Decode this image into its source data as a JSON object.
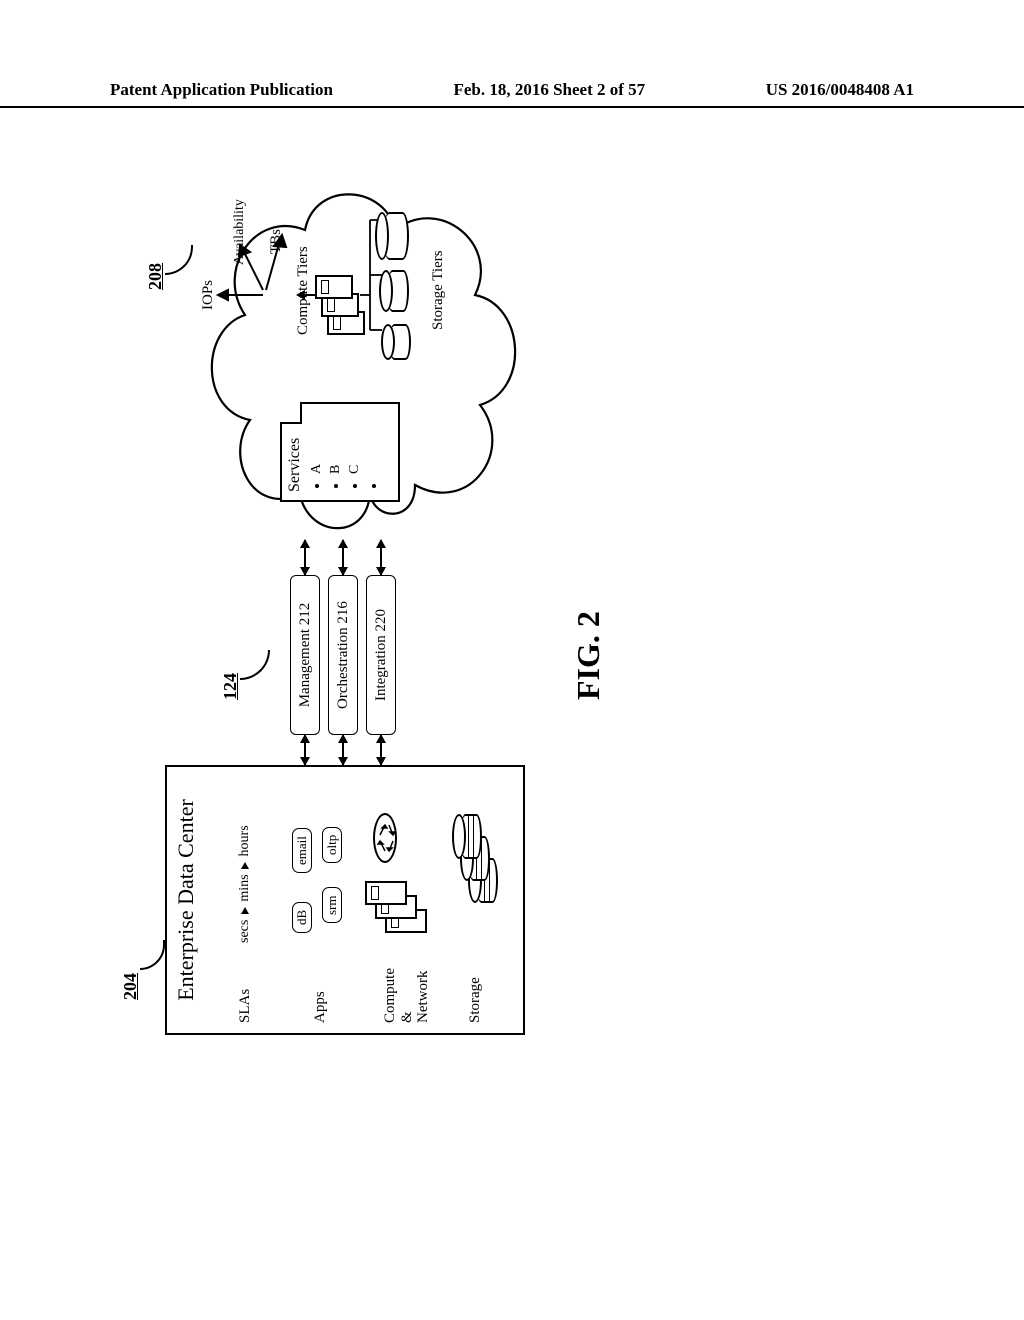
{
  "header": {
    "left": "Patent Application Publication",
    "center": "Feb. 18, 2016  Sheet 2 of 57",
    "right": "US 2016/0048408 A1"
  },
  "figure": {
    "label": "FIG.  2"
  },
  "refs": {
    "r204": "204",
    "r124": "124",
    "r208": "208"
  },
  "edc": {
    "title": "Enterprise Data Center",
    "rows": {
      "slas": "SLAs",
      "slas_value_parts": [
        "secs",
        "mins",
        "hours"
      ],
      "apps": "Apps",
      "compute_network": "Compute\n&\nNetwork",
      "storage": "Storage"
    },
    "apps": {
      "db": "dB",
      "email": "email",
      "srm": "srm",
      "oltp": "oltp"
    }
  },
  "middle": {
    "management": "Management 212",
    "orchestration": "Orchestration 216",
    "integration": "Integration 220"
  },
  "cloud": {
    "iops": "IOPs",
    "availability": "Availability",
    "tbs": "TBs",
    "compute_tiers": "Compute Tiers",
    "storage_tiers": "Storage Tiers",
    "services_title": "Services",
    "services": [
      "A",
      "B",
      "C",
      ""
    ]
  }
}
